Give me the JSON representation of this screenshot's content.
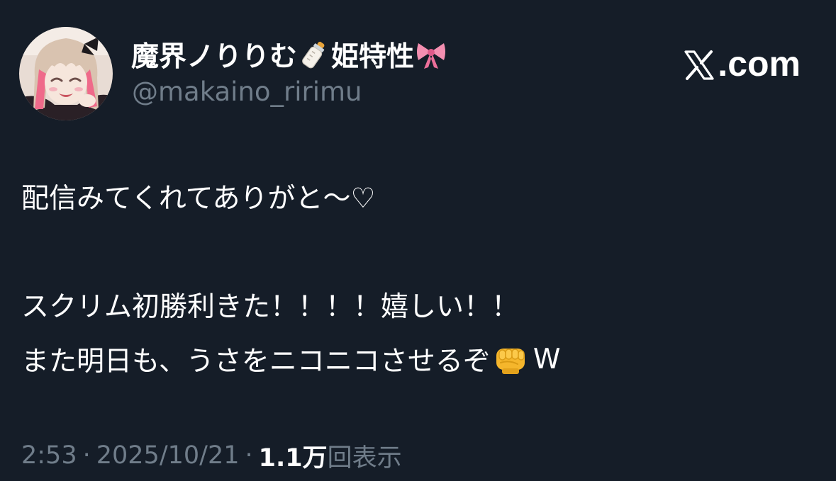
{
  "author": {
    "display_name_part1": "魔界ノりりむ",
    "display_name_part2": "姫特性",
    "name_emojis": [
      "baby-bottle-icon",
      "ribbon-icon"
    ],
    "handle": "@makaino_ririmu"
  },
  "brand": {
    "text": ".com",
    "logo_icon": "x-logo-icon"
  },
  "tweet": {
    "line1": "配信みてくれてありがと〜♡",
    "line2": "スクリム初勝利きた！！！！嬉しい！！",
    "line3_before_emoji": "また明日も、うさをニコニコさせるぞ",
    "line3_emoji": "oncoming-fist-icon",
    "line3_after_emoji": "W"
  },
  "meta": {
    "time": "2:53",
    "separator": "·",
    "date": "2025/10/21",
    "views_count": "1.1万",
    "views_label": "回表示"
  },
  "colors": {
    "background": "#151d28",
    "primary_text": "#ffffff",
    "secondary_text": "#707d8a"
  }
}
